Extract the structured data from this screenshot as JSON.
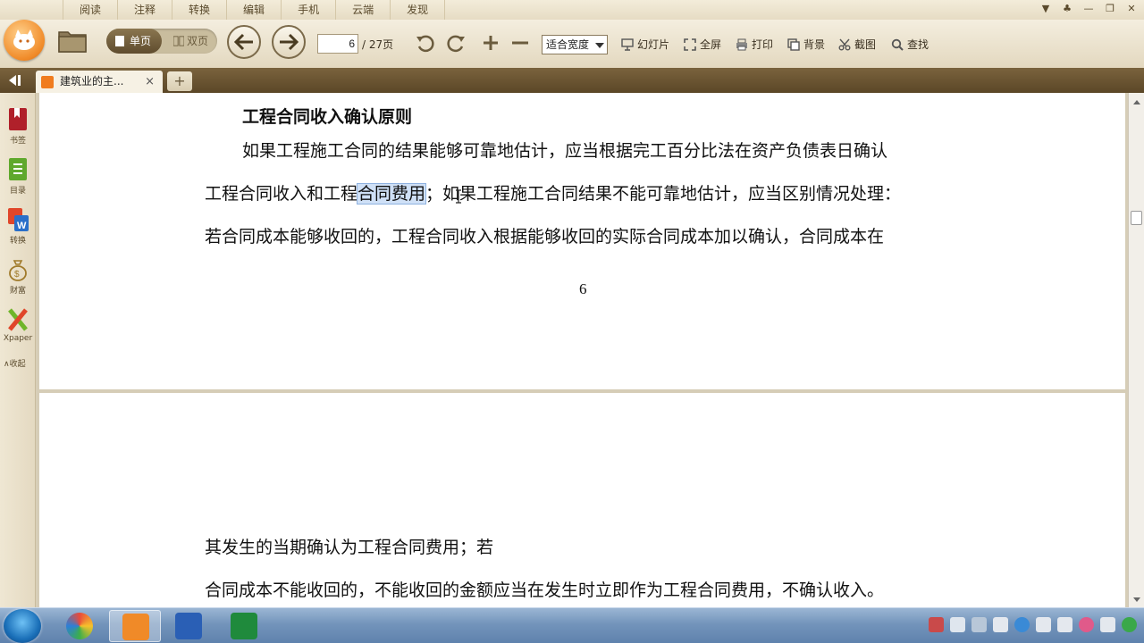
{
  "menu": {
    "items": [
      "阅读",
      "注释",
      "转换",
      "编辑",
      "手机",
      "云端",
      "发现"
    ]
  },
  "toolbar": {
    "view_single": "单页",
    "view_double": "双页",
    "current_page": "6",
    "total_pages": "/ 27页",
    "zoom": "适合宽度",
    "slideshow": "幻灯片",
    "fullscreen": "全屏",
    "print": "打印",
    "background": "背景",
    "screenshot": "截图",
    "find": "查找"
  },
  "tabs": {
    "items": [
      {
        "label": "建筑业的主..."
      }
    ],
    "close_glyph": "×",
    "add_glyph": "+"
  },
  "sidebar": {
    "bookmarks": "书签",
    "toc": "目录",
    "convert": "转换",
    "wealth": "财富",
    "xpaper": "Xpaper",
    "collapse": "∧收起"
  },
  "document": {
    "heading": "工程合同收入确认原则",
    "line1": "如果工程施工合同的结果能够可靠地估计，应当根据完工百分比法在资产负债表日确认",
    "line2_pre": "工程合同收入和工程",
    "line2_highlight": "合同费用",
    "line2_post": "；如果工程施工合同结果不能可靠地估计，应当区别情况处理：",
    "line3": "若合同成本能够收回的，工程合同收入根据能够收回的实际合同成本加以确认，合同成本在",
    "page_number": "6",
    "line4": "其发生的当期确认为工程合同费用；若",
    "line5": "合同成本不能收回的，不能收回的金额应当在发生时立即作为工程合同费用，不确认收入。"
  },
  "colors": {
    "accent": "#f08a28",
    "highlight": "#cfe0f6",
    "toolbar_bg": "#e8dfc9",
    "tabbar_bg": "#6b5532"
  }
}
